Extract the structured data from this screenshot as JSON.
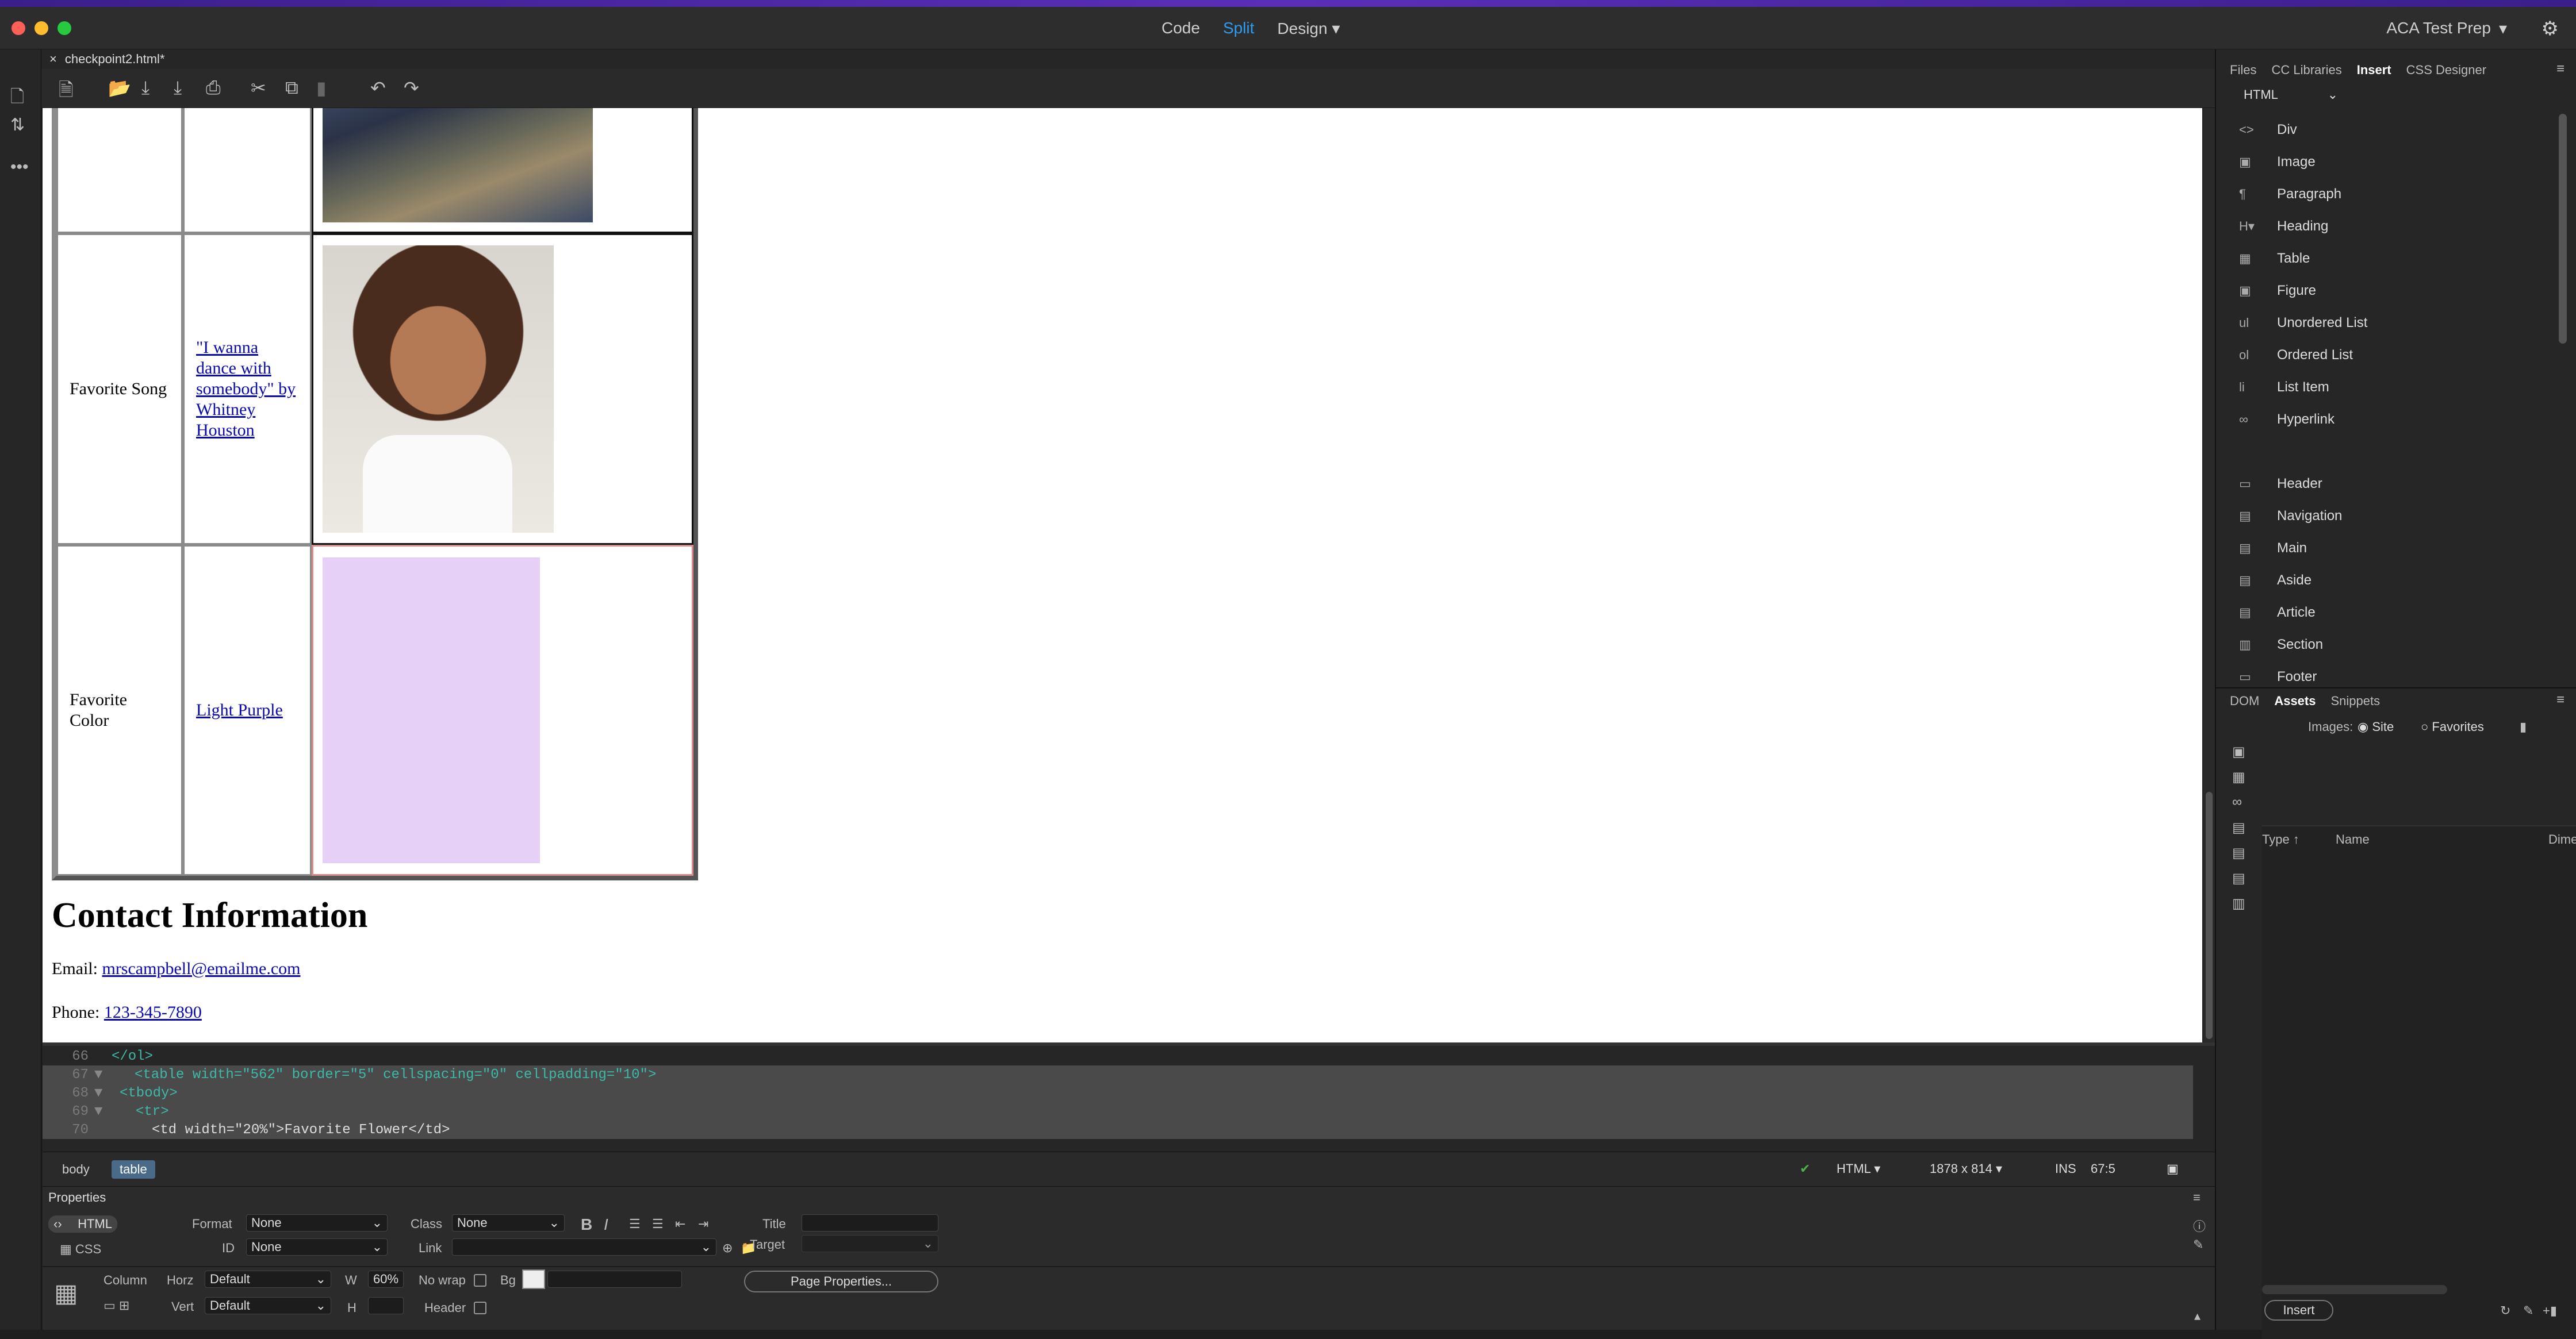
{
  "app": {
    "views": [
      "Code",
      "Split",
      "Design"
    ],
    "active_view": "Split",
    "workspace": "ACA Test Prep"
  },
  "document": {
    "tab_name": "checkpoint2.html*"
  },
  "design": {
    "rows": [
      {
        "label": "Favorite Song",
        "link": "\"I wanna dance with somebody\" by Whitney Houston"
      },
      {
        "label": "Favorite Color",
        "link": "Light Purple"
      }
    ],
    "contact": {
      "heading": "Contact Information",
      "email_label": "Email:",
      "email": "mrscampbell@emailme.com",
      "phone_label": "Phone:",
      "phone": "123-345-7890"
    }
  },
  "code": {
    "lines": [
      {
        "num": "66",
        "fold": "",
        "code": "</ol>"
      },
      {
        "num": "67",
        "fold": "▼",
        "code": "<table width=\"562\" border=\"5\" cellspacing=\"0\" cellpadding=\"10\">"
      },
      {
        "num": "68",
        "fold": "▼",
        "code": "<tbody>"
      },
      {
        "num": "69",
        "fold": "▼",
        "code": "<tr>"
      },
      {
        "num": "70",
        "fold": "",
        "code": "<td width=\"20%\">Favorite Flower</td>"
      }
    ]
  },
  "status": {
    "crumbs": [
      "body",
      "table"
    ],
    "doc_type": "HTML",
    "size": "1878 x 814",
    "mode": "INS",
    "position": "67:5"
  },
  "properties": {
    "title": "Properties",
    "html_tab": "HTML",
    "css_tab": "CSS",
    "format_label": "Format",
    "format_value": "None",
    "id_label": "ID",
    "id_value": "None",
    "class_label": "Class",
    "class_value": "None",
    "link_label": "Link",
    "title_label": "Title",
    "target_label": "Target",
    "column_label": "Column",
    "horz_label": "Horz",
    "horz_value": "Default",
    "vert_label": "Vert",
    "vert_value": "Default",
    "w_label": "W",
    "w_value": "60%",
    "h_label": "H",
    "nowrap_label": "No wrap",
    "bg_label": "Bg",
    "header_label": "Header",
    "page_props_button": "Page Properties..."
  },
  "right_panel": {
    "tabs": [
      "Files",
      "CC Libraries",
      "Insert",
      "CSS Designer"
    ],
    "active_tab": "Insert",
    "category": "HTML",
    "insert_items": [
      {
        "icon": "div-icon",
        "glyph": "<>",
        "label": "Div"
      },
      {
        "icon": "image-icon",
        "glyph": "▣",
        "label": "Image"
      },
      {
        "icon": "paragraph-icon",
        "glyph": "¶",
        "label": "Paragraph"
      },
      {
        "icon": "heading-icon",
        "glyph": "H▾",
        "label": "Heading"
      },
      {
        "icon": "table-icon",
        "glyph": "▦",
        "label": "Table"
      },
      {
        "icon": "figure-icon",
        "glyph": "▣",
        "label": "Figure"
      },
      {
        "icon": "ul-icon",
        "glyph": "ul",
        "label": "Unordered List"
      },
      {
        "icon": "ol-icon",
        "glyph": "ol",
        "label": "Ordered List"
      },
      {
        "icon": "li-icon",
        "glyph": "li",
        "label": "List Item"
      },
      {
        "icon": "hyperlink-icon",
        "glyph": "∞",
        "label": "Hyperlink"
      },
      {
        "icon": "header-icon",
        "glyph": "▭",
        "label": "Header"
      },
      {
        "icon": "navigation-icon",
        "glyph": "▤",
        "label": "Navigation"
      },
      {
        "icon": "main-icon",
        "glyph": "▤",
        "label": "Main"
      },
      {
        "icon": "aside-icon",
        "glyph": "▤",
        "label": "Aside"
      },
      {
        "icon": "article-icon",
        "glyph": "▤",
        "label": "Article"
      },
      {
        "icon": "section-icon",
        "glyph": "▥",
        "label": "Section"
      },
      {
        "icon": "footer-icon",
        "glyph": "▭",
        "label": "Footer"
      }
    ],
    "lower_tabs": [
      "DOM",
      "Assets",
      "Snippets"
    ],
    "lower_active": "Assets",
    "images_label": "Images:",
    "site_label": "Site",
    "favorites_label": "Favorites",
    "columns": [
      "Type",
      "Name",
      "Dime"
    ],
    "insert_button": "Insert"
  }
}
